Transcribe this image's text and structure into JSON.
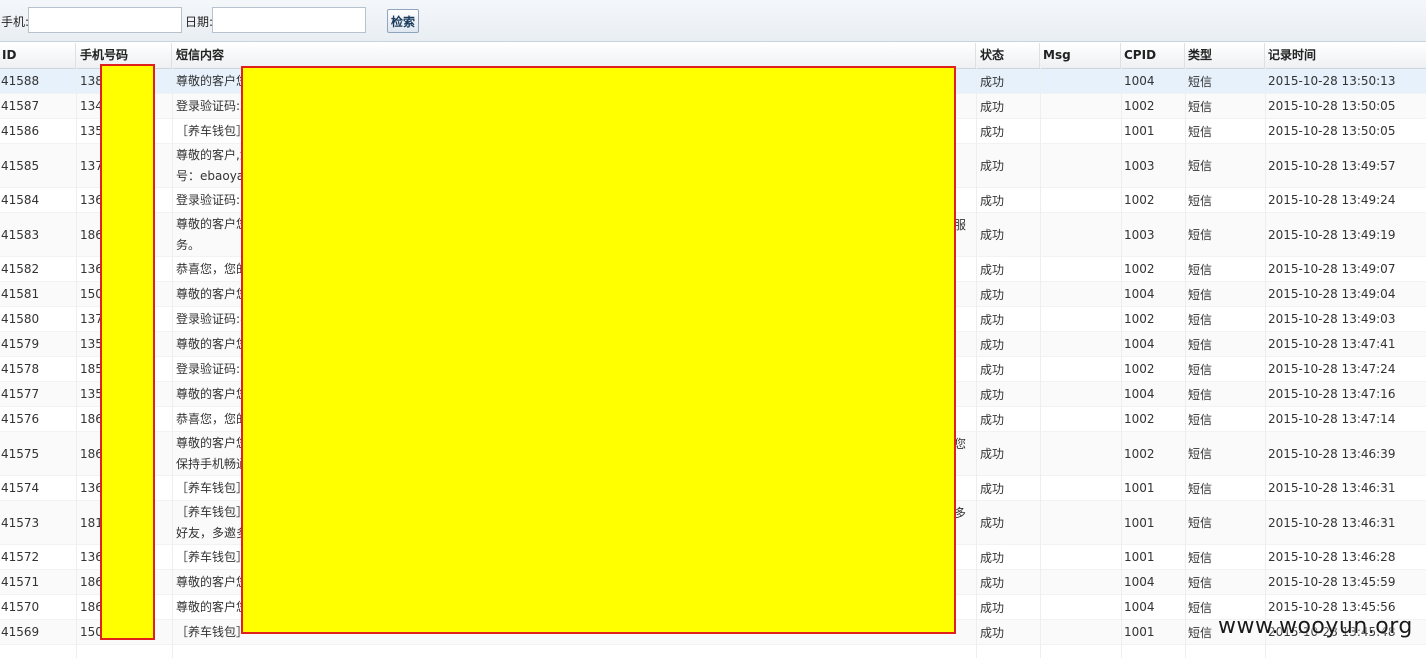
{
  "search": {
    "phone_label": "手机:",
    "phone_value": "",
    "date_label": "日期:",
    "date_value": "",
    "search_button": "检索"
  },
  "columns": [
    "ID",
    "手机号码",
    "短信内容",
    "状态",
    "Msg",
    "CPID",
    "类型",
    "记录时间"
  ],
  "rows": [
    {
      "id": "41588",
      "phone": "138",
      "sms": "尊敬的客户您",
      "status": "成功",
      "msg": "",
      "cpid": "1004",
      "type": "短信",
      "time": "2015-10-28 13:50:13"
    },
    {
      "id": "41587",
      "phone": "134",
      "sms": "登录验证码:2",
      "status": "成功",
      "msg": "",
      "cpid": "1002",
      "type": "短信",
      "time": "2015-10-28 13:50:05"
    },
    {
      "id": "41586",
      "phone": "135",
      "sms": "［养车钱包］",
      "status": "成功",
      "msg": "",
      "cpid": "1001",
      "type": "短信",
      "time": "2015-10-28 13:50:05"
    },
    {
      "id": "41585",
      "phone": "137",
      "sms": "尊敬的客户,您\n号：ebaoyai",
      "status": "成功",
      "msg": "",
      "cpid": "1003",
      "type": "短信",
      "time": "2015-10-28 13:49:57"
    },
    {
      "id": "41584",
      "phone": "136",
      "sms": "登录验证码:7",
      "status": "成功",
      "msg": "",
      "cpid": "1002",
      "type": "短信",
      "time": "2015-10-28 13:49:24"
    },
    {
      "id": "41583",
      "phone": "186",
      "sms": "尊敬的客户您\n务。",
      "status": "成功",
      "msg": "",
      "cpid": "1003",
      "type": "短信",
      "time": "2015-10-28 13:49:19",
      "tail": "服"
    },
    {
      "id": "41582",
      "phone": "136",
      "sms": "恭喜您，您的",
      "status": "成功",
      "msg": "",
      "cpid": "1002",
      "type": "短信",
      "time": "2015-10-28 13:49:07"
    },
    {
      "id": "41581",
      "phone": "150",
      "sms": "尊敬的客户您",
      "status": "成功",
      "msg": "",
      "cpid": "1004",
      "type": "短信",
      "time": "2015-10-28 13:49:04"
    },
    {
      "id": "41580",
      "phone": "137",
      "sms": "登录验证码:8",
      "status": "成功",
      "msg": "",
      "cpid": "1002",
      "type": "短信",
      "time": "2015-10-28 13:49:03"
    },
    {
      "id": "41579",
      "phone": "135",
      "sms": "尊敬的客户您",
      "status": "成功",
      "msg": "",
      "cpid": "1004",
      "type": "短信",
      "time": "2015-10-28 13:47:41"
    },
    {
      "id": "41578",
      "phone": "185",
      "sms": "登录验证码:1",
      "status": "成功",
      "msg": "",
      "cpid": "1002",
      "type": "短信",
      "time": "2015-10-28 13:47:24"
    },
    {
      "id": "41577",
      "phone": "135",
      "sms": "尊敬的客户您",
      "status": "成功",
      "msg": "",
      "cpid": "1004",
      "type": "短信",
      "time": "2015-10-28 13:47:16"
    },
    {
      "id": "41576",
      "phone": "186",
      "sms": "恭喜您，您的",
      "status": "成功",
      "msg": "",
      "cpid": "1002",
      "type": "短信",
      "time": "2015-10-28 13:47:14"
    },
    {
      "id": "41575",
      "phone": "186",
      "sms": "尊敬的客户您\n保持手机畅通",
      "status": "成功",
      "msg": "",
      "cpid": "1002",
      "type": "短信",
      "time": "2015-10-28 13:46:39",
      "tail": "您"
    },
    {
      "id": "41574",
      "phone": "136",
      "sms": "［养车钱包］",
      "status": "成功",
      "msg": "",
      "cpid": "1001",
      "type": "短信",
      "time": "2015-10-28 13:46:31"
    },
    {
      "id": "41573",
      "phone": "181",
      "sms": "［养车钱包］\n好友，多邀多",
      "status": "成功",
      "msg": "",
      "cpid": "1001",
      "type": "短信",
      "time": "2015-10-28 13:46:31",
      "tail": "多"
    },
    {
      "id": "41572",
      "phone": "136",
      "sms": "［养车钱包］",
      "status": "成功",
      "msg": "",
      "cpid": "1001",
      "type": "短信",
      "time": "2015-10-28 13:46:28"
    },
    {
      "id": "41571",
      "phone": "186",
      "sms": "尊敬的客户您",
      "status": "成功",
      "msg": "",
      "cpid": "1004",
      "type": "短信",
      "time": "2015-10-28 13:45:59"
    },
    {
      "id": "41570",
      "phone": "186",
      "sms": "尊敬的客户您",
      "status": "成功",
      "msg": "",
      "cpid": "1004",
      "type": "短信",
      "time": "2015-10-28 13:45:56"
    },
    {
      "id": "41569",
      "phone": "150",
      "sms": "［养车钱包］",
      "status": "成功",
      "msg": "",
      "cpid": "1001",
      "type": "短信",
      "time": "2015-10-28 13:45:48"
    }
  ],
  "watermark": "www.wooyun.org",
  "colors": {
    "redaction_fill": "#ffff00",
    "redaction_border": "#e0201b",
    "selected_row": "#e6f1fb"
  }
}
